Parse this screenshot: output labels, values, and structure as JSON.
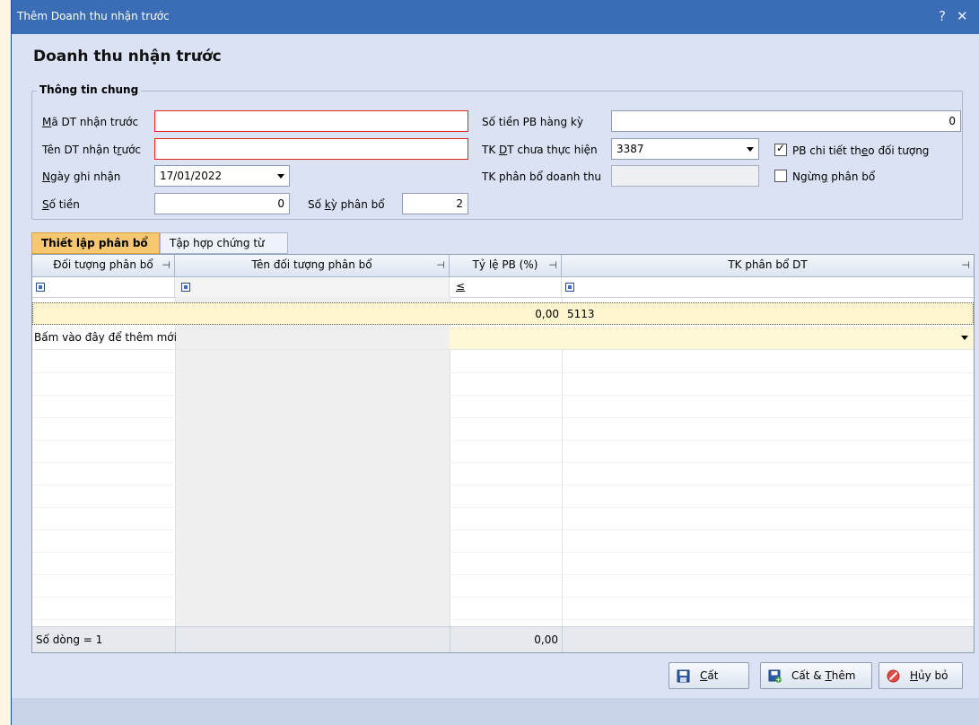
{
  "window": {
    "title": "Thêm Doanh thu nhận trước",
    "help_glyph": "?",
    "close_glyph": "✕"
  },
  "heading": "Doanh thu nhận trước",
  "group": {
    "title": "Thông tin chung",
    "ma_dt_label_a": "M",
    "ma_dt_label_b": "ã DT nhận trước",
    "ma_dt_value": "",
    "ten_dt_label_a": "Tên DT nhận t",
    "ten_dt_label_b": "r",
    "ten_dt_label_c": "ước",
    "ten_dt_value": "",
    "ngay_label_a": "N",
    "ngay_label_b": "gày ghi nhận",
    "ngay_value": "17/01/2022",
    "so_tien_label_a": "S",
    "so_tien_label_b": "ố tiền",
    "so_tien_value": "0",
    "so_ky_label_a": "Số ",
    "so_ky_label_b": "k",
    "so_ky_label_c": "ỳ phân bổ",
    "so_ky_value": "2",
    "so_tien_pb_label": "Số tiền PB hàng kỳ",
    "so_tien_pb_value": "0",
    "tk_dt_label_a": "TK ",
    "tk_dt_label_b": "D",
    "tk_dt_label_c": "T chưa thực hiện",
    "tk_dt_value": "3387",
    "tk_pb_label": "TK phân bổ doanh thu",
    "tk_pb_value": "",
    "pb_chi_tiet_label_a": "PB chi tiết th",
    "pb_chi_tiet_label_b": "e",
    "pb_chi_tiet_label_c": "o đối tượng",
    "pb_chi_tiet_checked": true,
    "ngung_label_a": "Ngừn",
    "ngung_label_b": "g",
    "ngung_label_c": " phân bổ",
    "ngung_checked": false
  },
  "tabs": [
    {
      "label": "Thiết lập phân bổ",
      "active": true
    },
    {
      "label": "Tập hợp chứng từ",
      "active": false
    }
  ],
  "grid": {
    "columns": [
      "Đối tượng phân bổ",
      "Tên đối tượng phân bổ",
      "Tỷ lệ PB (%)",
      "TK phân bổ DT"
    ],
    "pin_glyph": "⊣",
    "filter_le": "≤",
    "rows": [
      {
        "doi_tuong": "",
        "ten": "",
        "ty_le": "0,00",
        "tk": "5113"
      }
    ],
    "new_row_hint": "Bấm vào đây để thêm mới",
    "footer_count": "Số dòng = 1",
    "footer_total": "0,00"
  },
  "buttons": {
    "cat_a": "C",
    "cat_b": "ất",
    "cat_them_a": "Cất & ",
    "cat_them_b": "T",
    "cat_them_c": "hêm",
    "huy_a": "H",
    "huy_b": "ủy bỏ"
  },
  "colors": {
    "accent": "#3a6db5",
    "error_border": "#e32222",
    "tab_active": "#f7c870",
    "row_highlight": "#fff6cf"
  }
}
